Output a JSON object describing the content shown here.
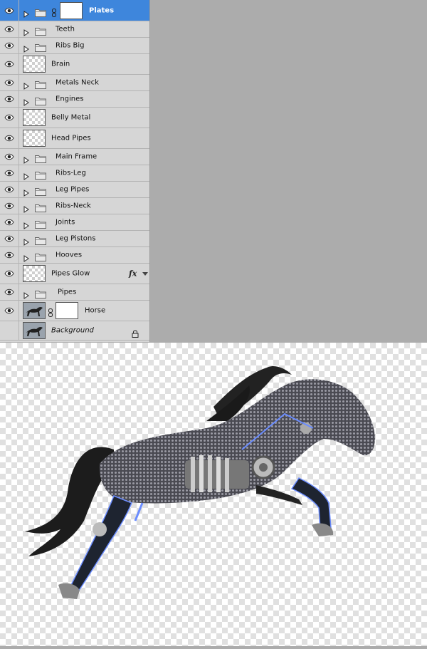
{
  "layers": [
    {
      "name": "Plates",
      "kind": "folder-mask",
      "selected": true
    },
    {
      "name": "Teeth",
      "kind": "folder"
    },
    {
      "name": "Ribs Big",
      "kind": "folder"
    },
    {
      "name": "Brain",
      "kind": "layer"
    },
    {
      "name": "Metals Neck",
      "kind": "folder"
    },
    {
      "name": "Engines",
      "kind": "folder"
    },
    {
      "name": "Belly Metal",
      "kind": "layer"
    },
    {
      "name": "Head Pipes",
      "kind": "layer"
    },
    {
      "name": "Main Frame",
      "kind": "folder"
    },
    {
      "name": "Ribs-Leg",
      "kind": "folder"
    },
    {
      "name": "Leg Pipes",
      "kind": "folder"
    },
    {
      "name": "Ribs-Neck",
      "kind": "folder"
    },
    {
      "name": "Joints",
      "kind": "folder"
    },
    {
      "name": "Leg Pistons",
      "kind": "folder"
    },
    {
      "name": "Hooves",
      "kind": "folder"
    },
    {
      "name": "Pipes Glow",
      "kind": "layer-fx"
    },
    {
      "name": "Pipes",
      "kind": "folder"
    },
    {
      "name": "Horse",
      "kind": "layer-mask"
    },
    {
      "name": "Background",
      "kind": "background-locked"
    }
  ],
  "fx_label": "fx",
  "icons": {
    "visibility": "eye-icon",
    "expand": "triangle-right-icon",
    "folder": "folder-icon",
    "link": "chain-link-icon",
    "lock": "lock-icon"
  },
  "colors": {
    "panel_bg": "#d6d6d6",
    "selected_row": "#3e86dc",
    "workspace": "#acacac",
    "horse_metal": "#5a5a62",
    "pipe_glow": "#6a8cff"
  }
}
